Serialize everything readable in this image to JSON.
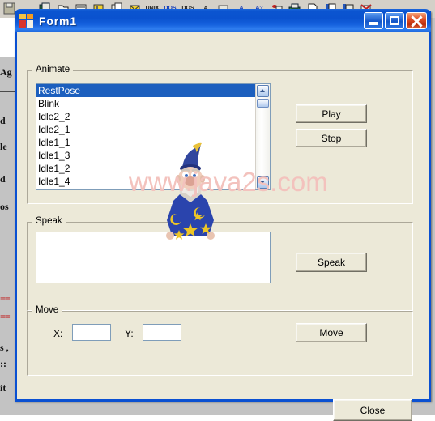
{
  "window": {
    "title": "Form1",
    "icon": "vb-form-icon",
    "caption_buttons": [
      {
        "name": "minimize-button",
        "label": "Minimize"
      },
      {
        "name": "maximize-button",
        "label": "Maximize"
      },
      {
        "name": "close-button",
        "label": "Close"
      }
    ],
    "titlebar_color": "#0a52cf",
    "body_color": "#ece9d8"
  },
  "groups": {
    "animate": {
      "label": "Animate",
      "listbox": {
        "items": [
          "RestPose",
          "Blink",
          "Idle2_2",
          "Idle2_1",
          "Idle1_1",
          "Idle1_3",
          "Idle1_2",
          "Idle1_4"
        ],
        "selected_index": 0,
        "selection_color": "#1c5fbe"
      },
      "buttons": {
        "play": "Play",
        "stop": "Stop"
      }
    },
    "speak": {
      "label": "Speak",
      "textbox_value": "",
      "textbox_placeholder": "",
      "button": "Speak"
    },
    "move": {
      "label": "Move",
      "x_label": "X:",
      "x_value": "",
      "y_label": "Y:",
      "y_value": "",
      "button": "Move"
    }
  },
  "footer": {
    "close_button": "Close"
  },
  "watermark": {
    "text": "www.java2s.com",
    "color": "#f3c2bd"
  },
  "background": {
    "toolbar_icons": [
      "save-icon",
      "",
      "print-preview-icon",
      "new-document-icon",
      "align-icon",
      "color-palette-icon",
      "copy-page-icon",
      "mail-icon",
      "UNIX",
      "DOS",
      "DOS",
      "text-find-icon",
      "frame-icon",
      "font-decrease-icon",
      "spell-check-icon",
      "database-icon",
      "printer-icon",
      "page-icon",
      "document-properties-icon",
      "document-edit-icon",
      "delete-icon"
    ],
    "code_lines": [
      "Ag",
      "d",
      "le",
      "d",
      "os",
      "==",
      "==",
      "s ,",
      "::",
      "it"
    ]
  }
}
